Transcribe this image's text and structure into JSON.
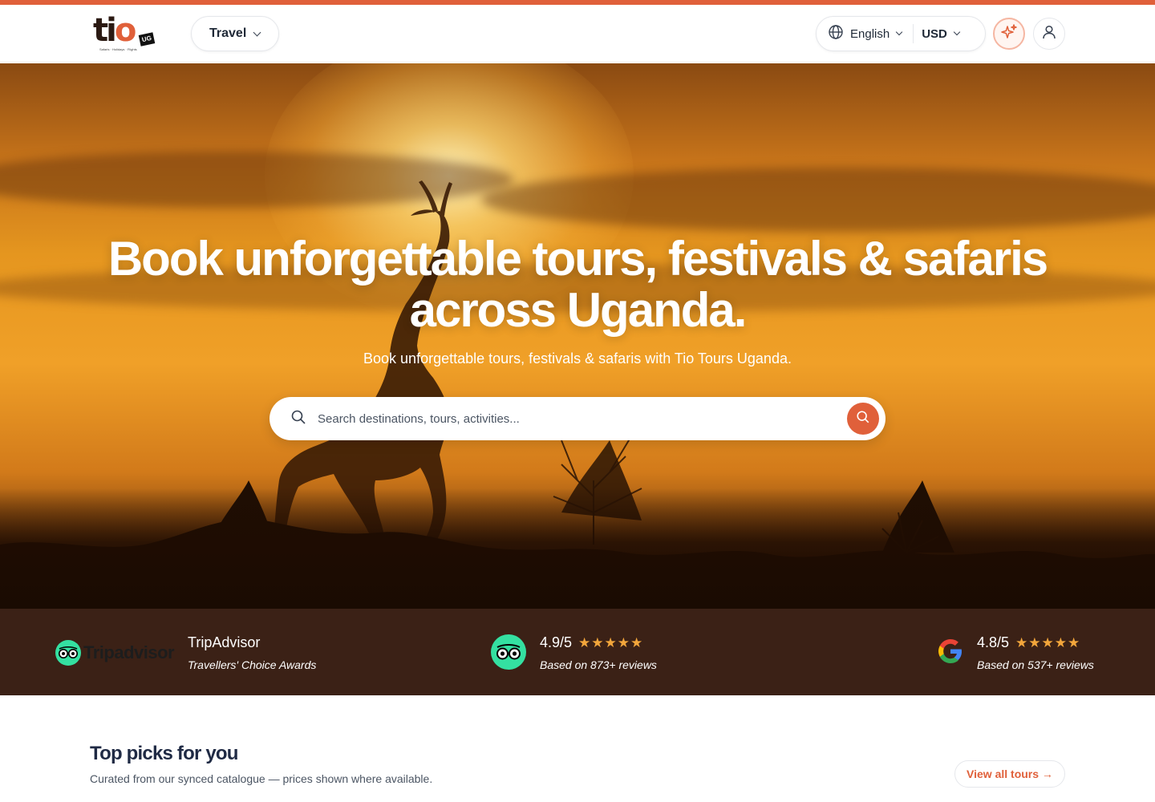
{
  "header": {
    "logo": {
      "word_main": "ti",
      "word_o": "o",
      "badge": "UG",
      "tagline": "Safaris · Holidays · Flights"
    },
    "travel_label": "Travel",
    "language_label": "English",
    "currency_label": "USD",
    "icons": {
      "language": "globe-icon",
      "ai": "sparkles-icon",
      "account": "user-icon"
    }
  },
  "hero": {
    "title": "Book unforgettable tours, festivals & safaris across Uganda.",
    "subtitle": "Book unforgettable tours, festivals & safaris with Tio Tours Uganda.",
    "search_placeholder": "Search destinations, tours, activities..."
  },
  "reviews": {
    "tripadvisor_word": "Tripadvisor",
    "items": [
      {
        "title": "TripAdvisor",
        "subtitle": "Travellers' Choice Awards"
      },
      {
        "title": "4.9/5",
        "stars": "★★★★★",
        "subtitle": "Based on 873+ reviews"
      },
      {
        "title": "4.8/5",
        "stars": "★★★★★",
        "subtitle": "Based on 537+ reviews"
      }
    ]
  },
  "picks": {
    "title": "Top picks for you",
    "subtitle": "Curated from our synced catalogue — prices shown where available.",
    "view_all": "View all tours →"
  },
  "colors": {
    "accent": "#e0603a",
    "band": "#3b2116",
    "star": "#f3a63b"
  }
}
